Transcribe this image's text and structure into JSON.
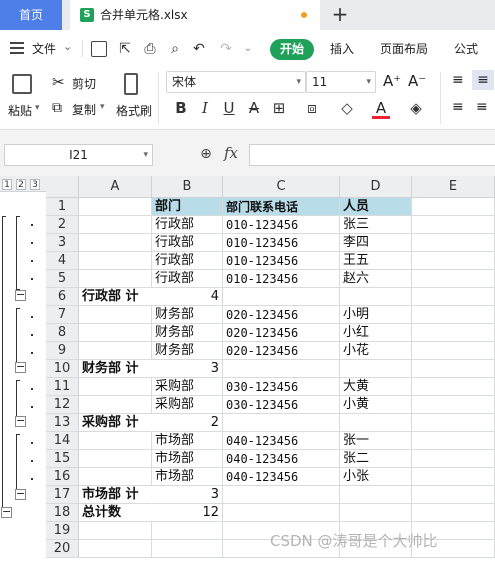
{
  "tabs": {
    "home": "首页",
    "file_icon": "S",
    "file_name": "合并单元格.xlsx",
    "add": "+"
  },
  "menu": {
    "file": "文件",
    "start": "开始",
    "items": [
      "插入",
      "页面布局",
      "公式"
    ]
  },
  "ribbon": {
    "paste": "粘贴",
    "cut": "剪切",
    "copy": "复制",
    "format_painter": "格式刷",
    "font": "宋体",
    "size": "11",
    "bold": "B",
    "italic": "I",
    "underline": "U"
  },
  "formula_bar": {
    "cell_ref": "I21",
    "fx": "fx",
    "value": ""
  },
  "outline": {
    "levels": [
      "1",
      "2",
      "3"
    ]
  },
  "columns": [
    "A",
    "B",
    "C",
    "D",
    "E"
  ],
  "rows": [
    {
      "n": "1",
      "a": "",
      "b": "部门",
      "c": "部门联系电话",
      "d": "人员",
      "type": "header"
    },
    {
      "n": "2",
      "a": "",
      "b": "行政部",
      "c": "010-123456",
      "d": "张三",
      "type": "data"
    },
    {
      "n": "3",
      "a": "",
      "b": "行政部",
      "c": "010-123456",
      "d": "李四",
      "type": "data"
    },
    {
      "n": "4",
      "a": "",
      "b": "行政部",
      "c": "010-123456",
      "d": "王五",
      "type": "data"
    },
    {
      "n": "5",
      "a": "",
      "b": "行政部",
      "c": "010-123456",
      "d": "赵六",
      "type": "data"
    },
    {
      "n": "6",
      "a": "行政部 计",
      "b": "4",
      "c": "",
      "d": "",
      "type": "subtotal"
    },
    {
      "n": "7",
      "a": "",
      "b": "财务部",
      "c": "020-123456",
      "d": "小明",
      "type": "data"
    },
    {
      "n": "8",
      "a": "",
      "b": "财务部",
      "c": "020-123456",
      "d": "小红",
      "type": "data"
    },
    {
      "n": "9",
      "a": "",
      "b": "财务部",
      "c": "020-123456",
      "d": "小花",
      "type": "data"
    },
    {
      "n": "10",
      "a": "财务部 计",
      "b": "3",
      "c": "",
      "d": "",
      "type": "subtotal"
    },
    {
      "n": "11",
      "a": "",
      "b": "采购部",
      "c": "030-123456",
      "d": "大黄",
      "type": "data"
    },
    {
      "n": "12",
      "a": "",
      "b": "采购部",
      "c": "030-123456",
      "d": "小黄",
      "type": "data"
    },
    {
      "n": "13",
      "a": "采购部 计",
      "b": "2",
      "c": "",
      "d": "",
      "type": "subtotal"
    },
    {
      "n": "14",
      "a": "",
      "b": "市场部",
      "c": "040-123456",
      "d": "张一",
      "type": "data"
    },
    {
      "n": "15",
      "a": "",
      "b": "市场部",
      "c": "040-123456",
      "d": "张二",
      "type": "data"
    },
    {
      "n": "16",
      "a": "",
      "b": "市场部",
      "c": "040-123456",
      "d": "小张",
      "type": "data"
    },
    {
      "n": "17",
      "a": "市场部 计",
      "b": "3",
      "c": "",
      "d": "",
      "type": "subtotal"
    },
    {
      "n": "18",
      "a": "总计数",
      "b": "12",
      "c": "",
      "d": "",
      "type": "subtotal"
    },
    {
      "n": "19",
      "a": "",
      "b": "",
      "c": "",
      "d": "",
      "type": "empty"
    },
    {
      "n": "20",
      "a": "",
      "b": "",
      "c": "",
      "d": "",
      "type": "empty"
    }
  ],
  "watermark": "CSDN @涛哥是个大帅比"
}
